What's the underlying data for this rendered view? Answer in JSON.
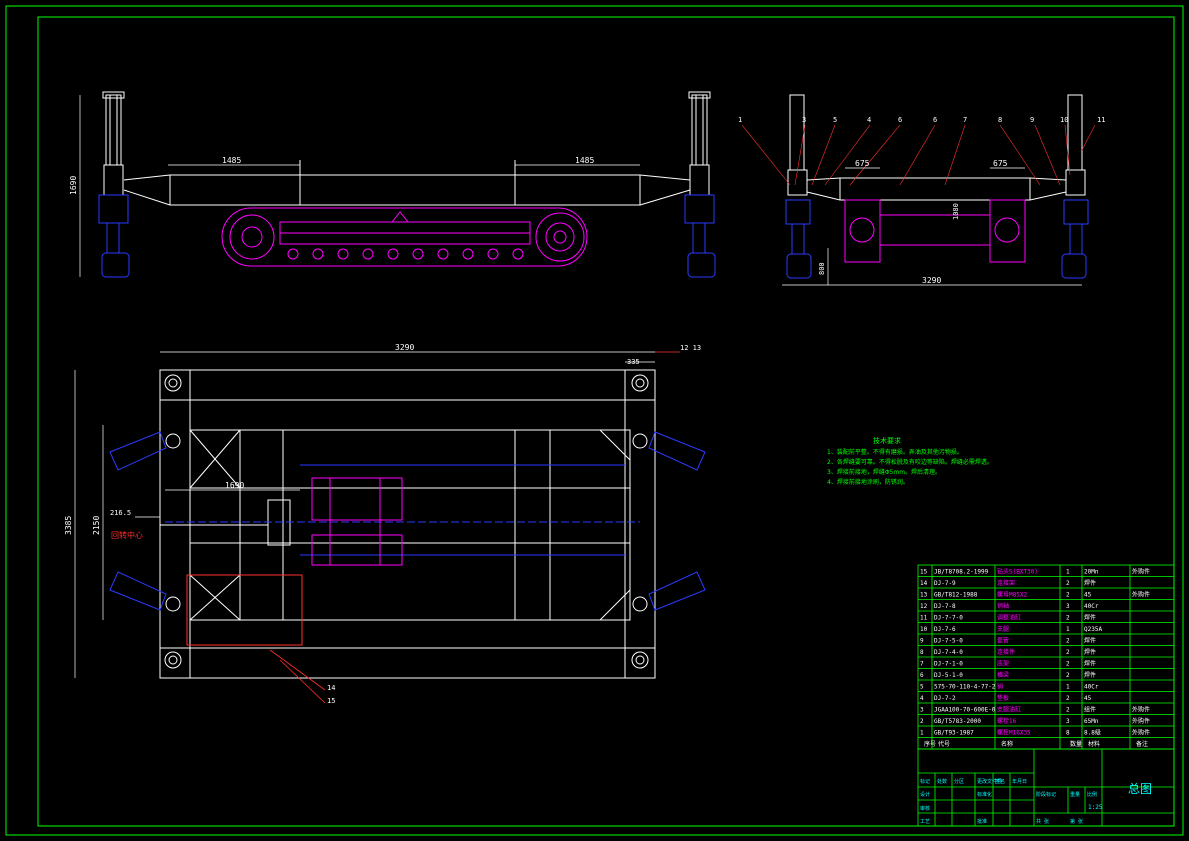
{
  "colors": {
    "background": "#000000",
    "frame": "#00ff00",
    "outline": "#ffffff",
    "magenta": "#ff00ff",
    "blue": "#2a3cff",
    "red": "#ff3030",
    "cyan": "#00ffff",
    "yellow_green": "#c8ff00"
  },
  "front_view": {
    "dim_left": "1485",
    "dim_right": "1485",
    "dim_height": "1690"
  },
  "side_view": {
    "callouts": [
      "1",
      "3",
      "5",
      "4",
      "6",
      "6",
      "7",
      "8",
      "9",
      "10",
      "11"
    ],
    "dim_left": "675",
    "dim_right": "675",
    "dim_width": "3290",
    "dim_mid": "1080",
    "dim_bottom": "800"
  },
  "plan_view": {
    "dim_top": "3290",
    "dim_top_right": "335",
    "callout_top": "12 13",
    "dim_length": "1690",
    "dim_offset": "216.5",
    "dim_height_outer": "3385",
    "dim_height_inner": "2150",
    "center_label": "回转中心",
    "callout_14": "14",
    "callout_15": "15"
  },
  "tech_notes": {
    "title": "技术要求",
    "lines": [
      "1、装配前平整。不得有磨损。弄油及其他污物损。",
      "2、各焊缝要可靠。不得松脱及有咬边等缺陷。焊缝必需焊透。",
      "3、焊接前接地，焊缝Φ5mm。焊后清理。",
      "4、焊接前接地涂刷，防锈润。"
    ]
  },
  "bom": {
    "rows": [
      [
        "15",
        "JB/T8708.2-1999",
        "钻头S(BXT30)",
        "1",
        "20Mn",
        "外购件"
      ],
      [
        "14",
        "DJ-7-9",
        "连接架",
        "2",
        "焊件",
        ""
      ],
      [
        "13",
        "GB/T812-1988",
        "螺母M85X2",
        "2",
        "45",
        "外购件"
      ],
      [
        "12",
        "DJ-7-8",
        "销轴",
        "3",
        "40Cr",
        ""
      ],
      [
        "11",
        "DJ-7-7-0",
        "调整油缸",
        "2",
        "焊件",
        ""
      ],
      [
        "10",
        "DJ-7-6",
        "支腿",
        "1",
        "Q235A",
        ""
      ],
      [
        "9",
        "DJ-7-5-0",
        "套管",
        "2",
        "焊件",
        ""
      ],
      [
        "8",
        "DJ-7-4-0",
        "连接件",
        "2",
        "焊件",
        ""
      ],
      [
        "7",
        "DJ-7-1-0",
        "底架",
        "2",
        "焊件",
        ""
      ],
      [
        "6",
        "DJ-5-1-0",
        "横梁",
        "2",
        "焊件",
        ""
      ],
      [
        "5",
        "575-70-110-4-77-2",
        "销",
        "1",
        "40Cr",
        ""
      ],
      [
        "4",
        "DJ-7-2",
        "垫板",
        "2",
        "45",
        ""
      ],
      [
        "3",
        "JGAA100-70-600E-0",
        "支腿油缸",
        "2",
        "组件",
        "外购件"
      ],
      [
        "2",
        "GB/T5783-2000",
        "螺栓16",
        "3",
        "65Mn",
        "外购件"
      ],
      [
        "1",
        "GB/T93-1987",
        "螺栓M16X35",
        "8",
        "8.8级",
        "外购件"
      ]
    ],
    "header": [
      "序号",
      "代号",
      "名称",
      "数量",
      "材料",
      "备注"
    ]
  },
  "title_block": {
    "title": "总图",
    "scale": "1:25",
    "labels_row1": [
      "标记",
      "处数",
      "分区",
      "更改文件号",
      "签名",
      "年月日"
    ],
    "label_design": "设计",
    "label_standard": "标准化",
    "label_stage": "阶段标记",
    "label_weight": "重量",
    "label_scale": "比例",
    "label_review": "审核",
    "label_process": "工艺",
    "label_approve": "批准",
    "label_sheets": "共 张",
    "label_sheet": "第 张"
  }
}
